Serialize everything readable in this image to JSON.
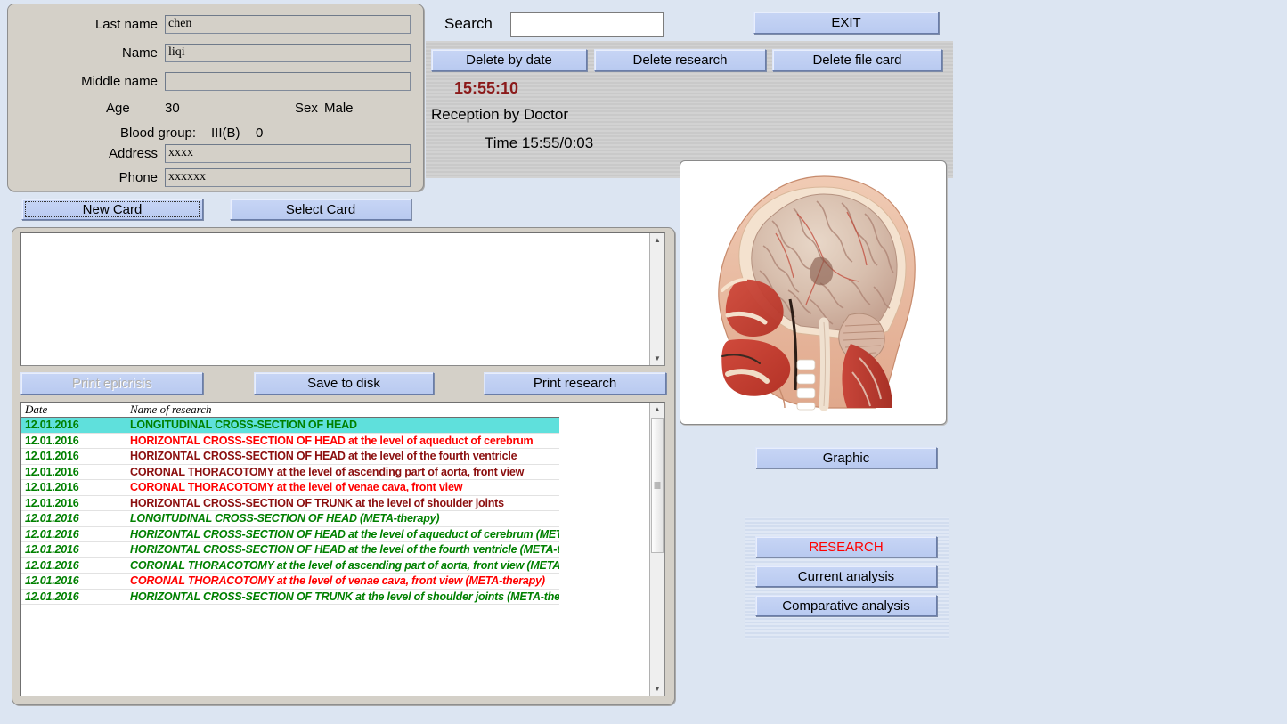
{
  "patient": {
    "fields": [
      {
        "label": "Last name",
        "value": "chen"
      },
      {
        "label": "Name",
        "value": "liqi"
      },
      {
        "label": "Middle name",
        "value": ""
      }
    ],
    "age_label": "Age",
    "age_value": "30",
    "sex_label": "Sex",
    "sex_value": "Male",
    "blood_label": "Blood group:",
    "blood_value": "III(B)",
    "rh_value": "0",
    "address_label": "Address",
    "address_value": "xxxx",
    "phone_label": "Phone",
    "phone_value": "xxxxxx"
  },
  "search": {
    "label": "Search",
    "value": "",
    "placeholder": ""
  },
  "toolbar": {
    "exit_label": "EXIT",
    "delete_by_date_label": "Delete by date",
    "delete_research_label": "Delete research",
    "delete_file_card_label": "Delete file card"
  },
  "session": {
    "clock": "15:55:10",
    "reception_label": "Reception by Doctor",
    "time_label": "Time 15:55/0:03"
  },
  "card_buttons": {
    "new_card_label": "New Card",
    "select_card_label": "Select Card"
  },
  "notes": {
    "text": ""
  },
  "actions": {
    "print_epicrisis_label": "Print epicrisis",
    "save_to_disk_label": "Save to disk",
    "print_research_label": "Print research"
  },
  "research_list": {
    "columns": [
      "Date",
      "Name of research"
    ],
    "rows": [
      {
        "date": "12.01.2016",
        "name": "LONGITUDINAL CROSS-SECTION OF HEAD",
        "color": "green",
        "selected": true,
        "meta": false
      },
      {
        "date": "12.01.2016",
        "name": "HORIZONTAL CROSS-SECTION OF HEAD at the level of aqueduct of cerebrum",
        "color": "red",
        "selected": false,
        "meta": false
      },
      {
        "date": "12.01.2016",
        "name": "HORIZONTAL CROSS-SECTION OF HEAD at the level of the fourth ventricle",
        "color": "darkred",
        "selected": false,
        "meta": false
      },
      {
        "date": "12.01.2016",
        "name": "CORONAL THORACOTOMY at the level of ascending part of aorta, front view",
        "color": "darkred",
        "selected": false,
        "meta": false
      },
      {
        "date": "12.01.2016",
        "name": "CORONAL THORACOTOMY at the level of venae cava, front view",
        "color": "red",
        "selected": false,
        "meta": false
      },
      {
        "date": "12.01.2016",
        "name": "HORIZONTAL CROSS-SECTION OF TRUNK at the level of shoulder joints",
        "color": "darkred",
        "selected": false,
        "meta": false
      },
      {
        "date": "12.01.2016",
        "name": "LONGITUDINAL CROSS-SECTION OF HEAD (META-therapy)",
        "color": "green",
        "selected": false,
        "meta": true
      },
      {
        "date": "12.01.2016",
        "name": "HORIZONTAL CROSS-SECTION OF HEAD at the level of aqueduct of cerebrum (META-therapy)",
        "color": "green",
        "selected": false,
        "meta": true
      },
      {
        "date": "12.01.2016",
        "name": "HORIZONTAL CROSS-SECTION OF HEAD at the level of the fourth ventricle (META-therapy)",
        "color": "green",
        "selected": false,
        "meta": true
      },
      {
        "date": "12.01.2016",
        "name": "CORONAL THORACOTOMY at the level of ascending part of aorta, front view (META-therapy)",
        "color": "green",
        "selected": false,
        "meta": true
      },
      {
        "date": "12.01.2016",
        "name": "CORONAL THORACOTOMY at the level of venae cava, front view (META-therapy)",
        "color": "red",
        "selected": false,
        "meta": true
      },
      {
        "date": "12.01.2016",
        "name": "HORIZONTAL CROSS-SECTION OF TRUNK at the level of shoulder joints (META-therapy)",
        "color": "green",
        "selected": false,
        "meta": true
      }
    ]
  },
  "preview": {
    "image_name": "sagittal-head-cross-section-image"
  },
  "right_panel": {
    "graphic_label": "Graphic",
    "research_label": "RESEARCH",
    "current_analysis_label": "Current analysis",
    "comparative_analysis_label": "Comparative analysis"
  },
  "colors": {
    "page_background": "#dce5f2",
    "panel_background": "#d4d0c8",
    "button_face": "#c3d2f2",
    "selection": "#5fe0dc",
    "row_green": "#008000",
    "row_red": "#ff0000",
    "row_darkred": "#8b0f0f",
    "clock_red": "#8b1a1a",
    "research_accent": "#ff0000"
  }
}
